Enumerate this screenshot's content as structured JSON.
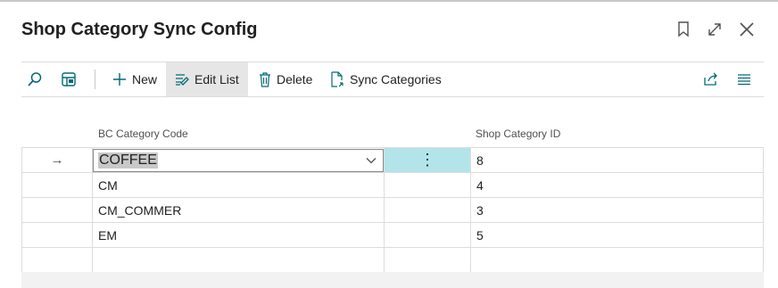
{
  "window": {
    "title": "Shop Category Sync Config"
  },
  "toolbar": {
    "new_label": "New",
    "edit_list_label": "Edit List",
    "delete_label": "Delete",
    "sync_label": "Sync Categories"
  },
  "columns": {
    "code": "BC Category Code",
    "shop_id": "Shop Category ID"
  },
  "rows": [
    {
      "code": "COFFEE",
      "shop_id": "8"
    },
    {
      "code": "CM",
      "shop_id": "4"
    },
    {
      "code": "CM_COMMER",
      "shop_id": "3"
    },
    {
      "code": "EM",
      "shop_id": "5"
    }
  ],
  "icons": {
    "current_row": "→",
    "row_menu": "⋮"
  },
  "colors": {
    "accent": "#006a75",
    "selected_cell": "#b2e4ea"
  }
}
